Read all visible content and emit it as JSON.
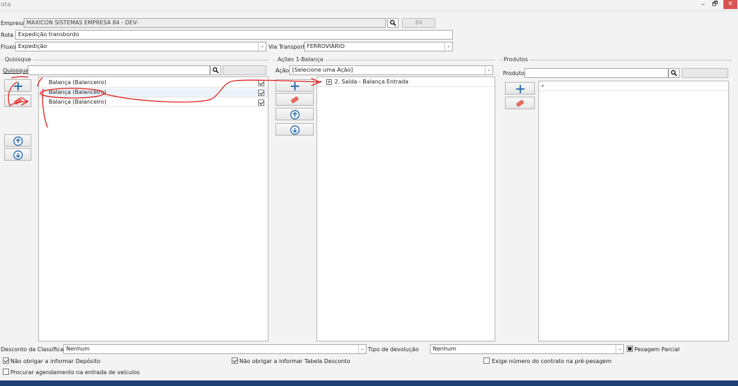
{
  "window": {
    "title": "ota",
    "controls": [
      "–",
      "🗗",
      "✕"
    ]
  },
  "empresa": {
    "label": "Empresa",
    "value": "MAXICON SISTEMAS EMPRESA 84 - DEV-",
    "code": "84"
  },
  "rota": {
    "label": "Rota",
    "value": "Expedição transbordo"
  },
  "fluxo": {
    "label": "Fluxo",
    "value": "Expedição"
  },
  "via": {
    "label": "Via Transporte",
    "value": "FERROVIÁRIO"
  },
  "quiosque": {
    "group": "Quiosque",
    "label": "Quiosque",
    "value": "",
    "items": [
      {
        "label": "Balança (Balanceiro)",
        "checked": true
      },
      {
        "label": "Balança (Balanceiro)",
        "checked": true
      },
      {
        "label": "Balança (Balanceiro)",
        "checked": true
      }
    ]
  },
  "acoes": {
    "group": "Ações 1-Balança",
    "label": "Ação",
    "value": "[Selecione uma Ação]",
    "tree_item": "2. Saída - Balança Entrada"
  },
  "produtos": {
    "group": "Produtos",
    "label": "Produto",
    "value": ""
  },
  "footer": {
    "desconto_label": "Desconto da Classificação",
    "desconto_value": "Nenhum",
    "devolucao_label": "Tipo de devolução",
    "devolucao_value": "Nenhum",
    "pesagem": "Pesagem Parcial",
    "nao_deposito": "Não obrigar a informar Depósito",
    "nao_tabela": "Não obrigar a informar Tabela Desconto",
    "exige": "Exige número do contrato na pré-pesagem",
    "procurar": "Procurar agendamento na entrada de veículos"
  },
  "colors": {
    "accent": "#2d6fb0",
    "close": "#d9534f",
    "annotation": "#e0201a",
    "taskbar": "#1d3f73"
  }
}
